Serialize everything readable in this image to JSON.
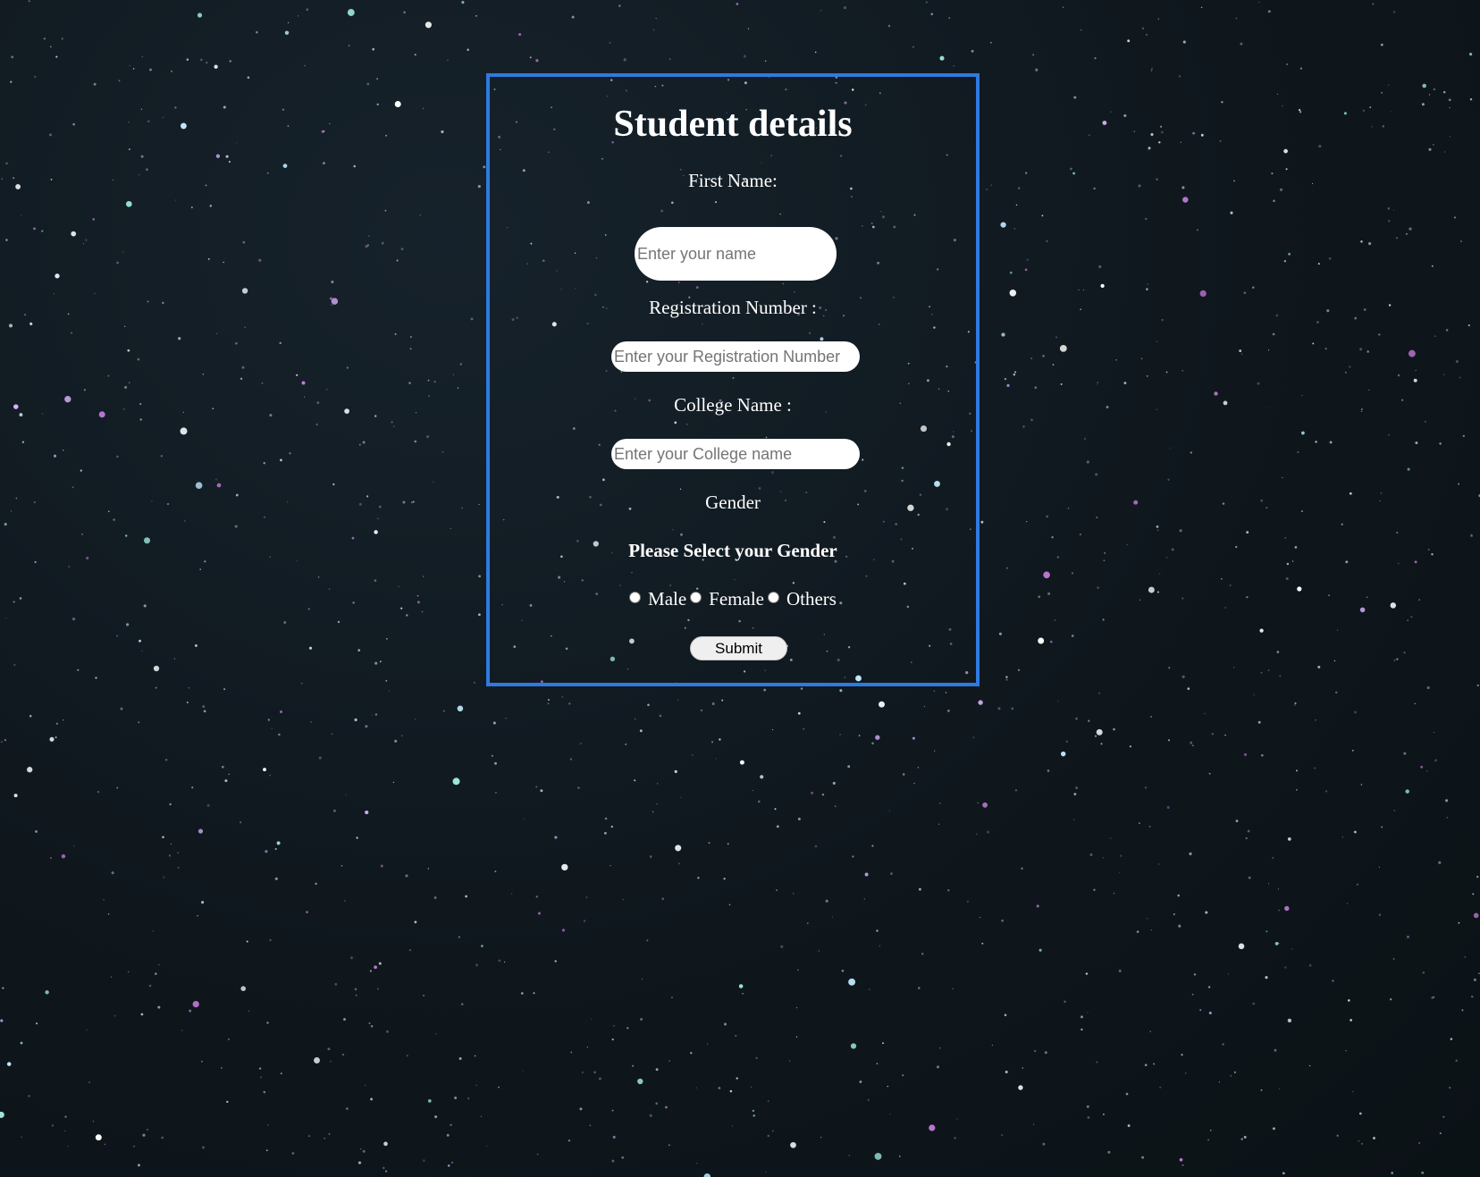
{
  "form": {
    "title": "Student details",
    "first_name_label": "First Name:",
    "first_name_placeholder": "Enter your name",
    "first_name_value": "",
    "registration_label": "Registration Number :",
    "registration_placeholder": "Enter your Registration Number",
    "registration_value": "",
    "college_label": "College Name :",
    "college_placeholder": "Enter your College name",
    "college_value": "",
    "gender_label": "Gender",
    "gender_prompt": "Please Select your Gender",
    "gender_options": [
      "Male",
      "Female",
      "Others"
    ],
    "submit_label": "Submit"
  },
  "colors": {
    "border": "#2f7ae0",
    "background": "#111a20",
    "text": "#ffffff"
  }
}
